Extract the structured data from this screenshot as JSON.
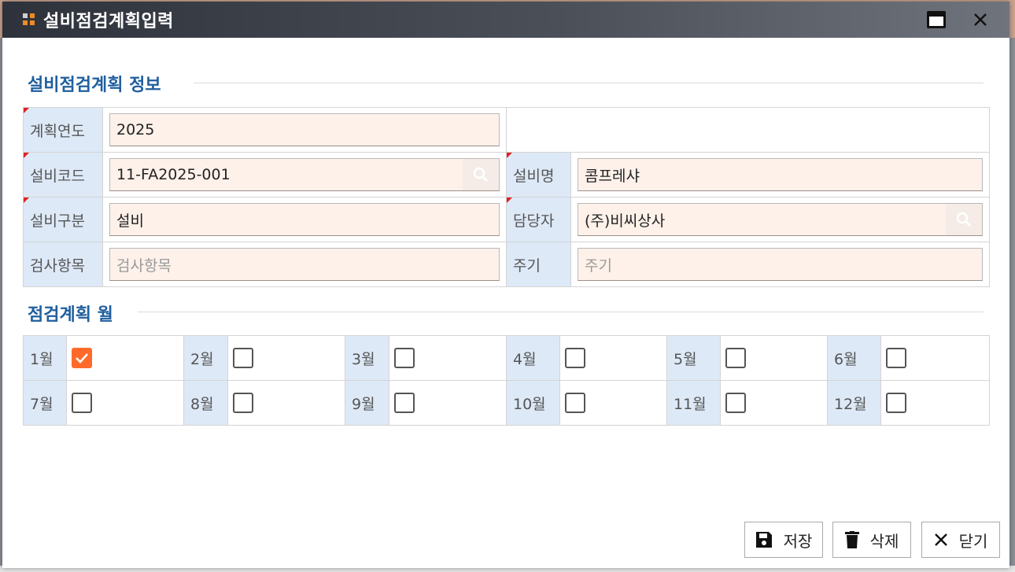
{
  "window": {
    "title": "설비점검계획입력"
  },
  "sections": {
    "info_title": "설비점검계획 정보",
    "months_title": "점검계획 월"
  },
  "fields": {
    "plan_year": {
      "label": "계획연도",
      "value": "2025"
    },
    "equipment_code": {
      "label": "설비코드",
      "value": "11-FA2025-001"
    },
    "equipment_name": {
      "label": "설비명",
      "value": "콤프레샤"
    },
    "equipment_type": {
      "label": "설비구분",
      "value": "설비"
    },
    "manager": {
      "label": "담당자",
      "value": "(주)비씨상사"
    },
    "inspection_item": {
      "label": "검사항목",
      "placeholder": "검사항목"
    },
    "cycle": {
      "label": "주기",
      "placeholder": "주기"
    }
  },
  "months": [
    {
      "label": "1월",
      "checked": true
    },
    {
      "label": "2월",
      "checked": false
    },
    {
      "label": "3월",
      "checked": false
    },
    {
      "label": "4월",
      "checked": false
    },
    {
      "label": "5월",
      "checked": false
    },
    {
      "label": "6월",
      "checked": false
    },
    {
      "label": "7월",
      "checked": false
    },
    {
      "label": "8월",
      "checked": false
    },
    {
      "label": "9월",
      "checked": false
    },
    {
      "label": "10월",
      "checked": false
    },
    {
      "label": "11월",
      "checked": false
    },
    {
      "label": "12월",
      "checked": false
    }
  ],
  "buttons": {
    "save": "저장",
    "delete": "삭제",
    "close": "닫기"
  },
  "colors": {
    "accent": "#ff6a2a",
    "section_title": "#1f5f9e",
    "label_bg": "#dde9f7",
    "input_bg": "#fdf1ea",
    "required_marker": "#e02020"
  },
  "icons": {
    "title": "grid-icon",
    "maximize": "window-icon",
    "close": "close-icon",
    "search": "search-icon",
    "save": "floppy-icon",
    "delete": "trash-icon",
    "dismiss": "x-icon"
  }
}
